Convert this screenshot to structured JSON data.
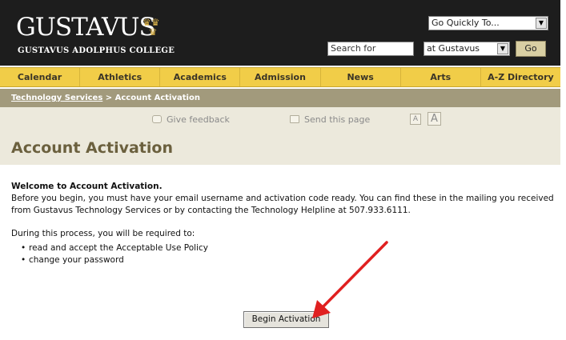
{
  "header": {
    "logo_text": "GUSTAVUS",
    "logo_subtitle": "GUSTAVUS ADOLPHUS COLLEGE",
    "quick_select": "Go Quickly To...",
    "search_placeholder": "Search for",
    "scope_select": "at Gustavus",
    "go_label": "Go"
  },
  "nav": {
    "items": [
      "Calendar",
      "Athletics",
      "Academics",
      "Admission",
      "News",
      "Arts",
      "A-Z Directory"
    ]
  },
  "breadcrumb": {
    "link": "Technology Services",
    "separator": " > ",
    "current": "Account Activation"
  },
  "tools": {
    "feedback": "Give feedback",
    "send_page": "Send this page",
    "text_small": "A",
    "text_large": "A"
  },
  "page": {
    "title": "Account Activation",
    "welcome": "Welcome to Account Activation.",
    "intro": "Before you begin, you must have your email username and activation code ready. You can find these in the mailing you received from Gustavus Technology Services or by contacting the Technology Helpline at 507.933.6111.",
    "process_intro": "During this process, you will be required to:",
    "steps": [
      "read and accept the Acceptable Use Policy",
      "change your password"
    ],
    "begin_button": "Begin Activation"
  },
  "annotation": {
    "arrow_color": "#e02020"
  }
}
